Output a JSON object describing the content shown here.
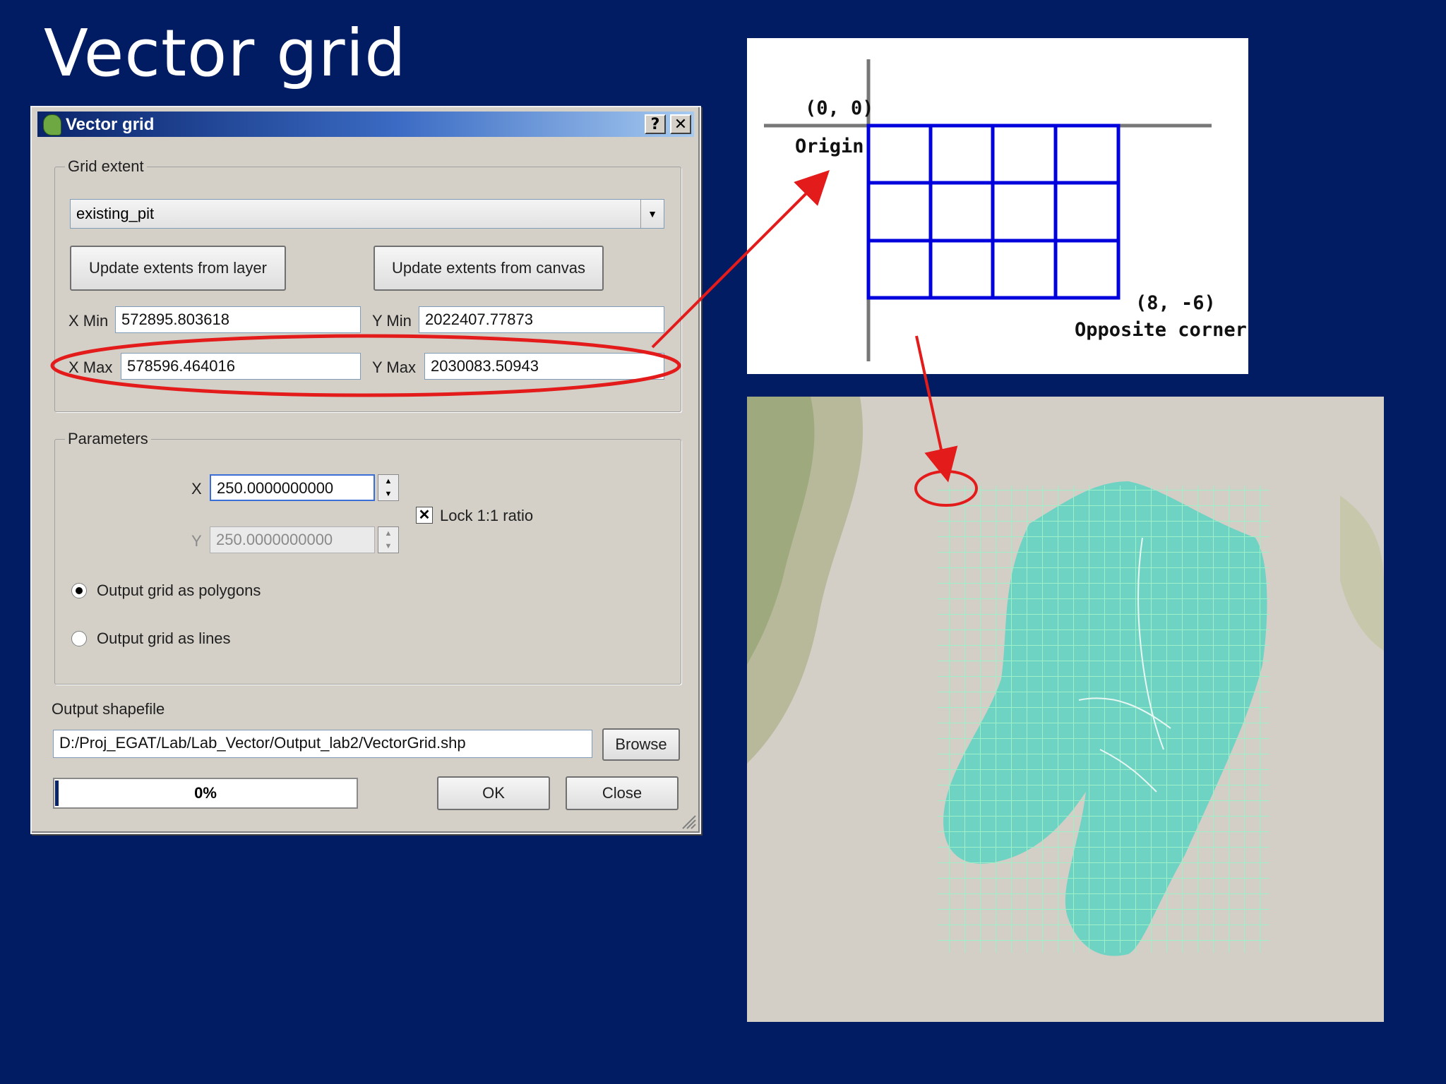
{
  "slide": {
    "title": "Vector grid"
  },
  "dialog": {
    "title": "Vector grid",
    "help_icon": "?",
    "close_icon": "✕",
    "grid_extent": {
      "label": "Grid extent",
      "layer_value": "existing_pit",
      "update_from_layer": "Update extents from layer",
      "update_from_canvas": "Update extents from canvas",
      "xmin_label": "X Min",
      "xmin_value": "572895.803618",
      "ymin_label": "Y Min",
      "ymin_value": "2022407.77873",
      "xmax_label": "X Max",
      "xmax_value": "578596.464016",
      "ymax_label": "Y Max",
      "ymax_value": "2030083.50943"
    },
    "parameters": {
      "label": "Parameters",
      "x_label": "X",
      "x_value": "250.0000000000",
      "y_label": "Y",
      "y_value": "250.0000000000",
      "lock_label": "Lock 1:1 ratio",
      "lock_checked": true,
      "polygons_label": "Output grid as polygons",
      "polygons_selected": true,
      "lines_label": "Output grid as lines",
      "lines_selected": false
    },
    "output": {
      "label": "Output shapefile",
      "path": "D:/Proj_EGAT/Lab/Lab_Vector/Output_lab2/VectorGrid.shp",
      "browse": "Browse"
    },
    "progress": {
      "value": 0,
      "text": "0%"
    },
    "ok": "OK",
    "close": "Close"
  },
  "diagram": {
    "origin_coords": "(0, 0)",
    "origin_label": "Origin",
    "corner_coords": "(8, -6)",
    "corner_label": "Opposite corner",
    "grid_color": "#0000dd"
  },
  "colors": {
    "slide_bg": "#011c62",
    "highlight": "#e31b1b",
    "map_fill": "#6fd3c4",
    "map_grid": "#9ef0c8"
  }
}
